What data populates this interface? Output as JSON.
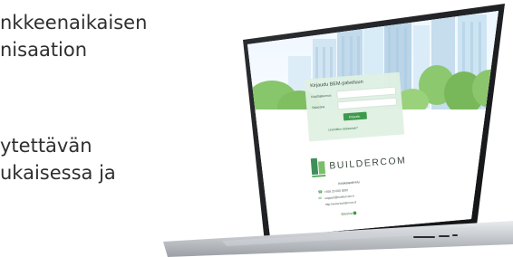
{
  "hero": {
    "lines": [
      "nkkeenaikaisen",
      "nisaation",
      "ytettävän",
      "ukaisessa ja"
    ]
  },
  "login": {
    "title": "Kirjaudu BEM-palveluun",
    "username_label": "Käyttäjätunnus",
    "password_label": "Salasana",
    "submit_label": "Kirjaudu",
    "forgot_link": "Unohditko salasanasi?"
  },
  "brand": {
    "name": "BUILDERCOM"
  },
  "contact": {
    "heading": "Asiakaspalvelu",
    "phone": "+358 20 000 0000",
    "email": "support@buildercom.fi",
    "url": "http://www.buildercom.fi",
    "footer_link": "Etusivu"
  },
  "colors": {
    "accent": "#3d9a4c",
    "text": "#2f2f2f"
  }
}
